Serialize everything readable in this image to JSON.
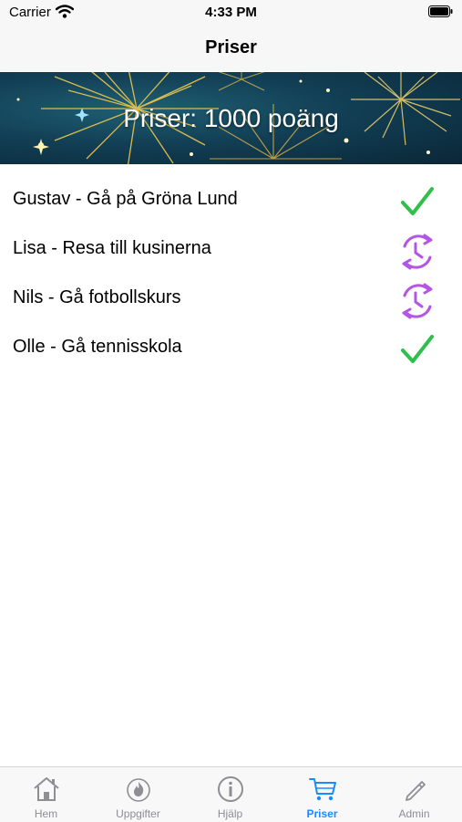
{
  "status_bar": {
    "carrier": "Carrier",
    "time": "4:33 PM"
  },
  "nav": {
    "title": "Priser"
  },
  "banner": {
    "text": "Priser: 1000 poäng"
  },
  "prizes": [
    {
      "label": "Gustav - Gå på Gröna Lund",
      "status": "check-icon"
    },
    {
      "label": "Lisa - Resa till kusinerna",
      "status": "pending-clock-icon"
    },
    {
      "label": "Nils - Gå fotbollskurs",
      "status": "pending-clock-icon"
    },
    {
      "label": "Olle - Gå tennisskola",
      "status": "check-icon"
    }
  ],
  "tabs": [
    {
      "label": "Hem",
      "icon": "home-icon",
      "active": false
    },
    {
      "label": "Uppgifter",
      "icon": "flame-icon",
      "active": false
    },
    {
      "label": "Hjälp",
      "icon": "info-icon",
      "active": false
    },
    {
      "label": "Priser",
      "icon": "cart-icon",
      "active": true
    },
    {
      "label": "Admin",
      "icon": "pencil-icon",
      "active": false
    }
  ],
  "colors": {
    "check": "#2ec04a",
    "pending": "#b455e6",
    "active_tab": "#1a8cff",
    "inactive_tab": "#8e8e93"
  }
}
